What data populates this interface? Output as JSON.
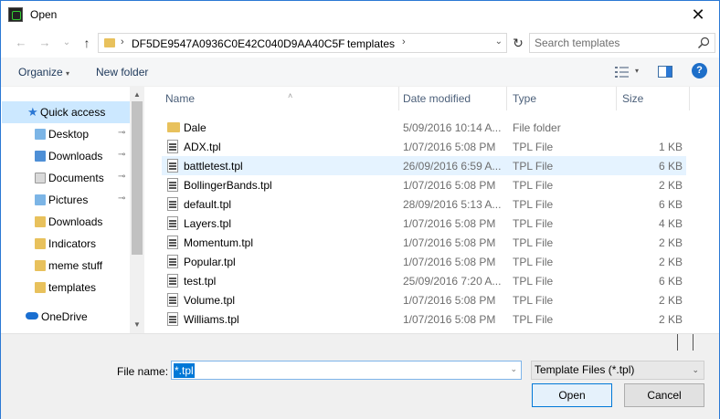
{
  "window": {
    "title": "Open",
    "close_symbol": "✕",
    "icons": {
      "app": "app-icon",
      "close": "close-icon"
    }
  },
  "nav": {
    "back_symbol": "←",
    "forward_symbol": "→",
    "recent_symbol": "⌄",
    "up_symbol": "↑",
    "refresh_symbol": "↻",
    "breadcrumb": [
      "DF5DE9547A0936C0E42C040D9AA40C5F",
      "templates"
    ],
    "breadcrumb_sep": "›",
    "search_placeholder": "Search templates"
  },
  "toolbar": {
    "organize_label": "Organize",
    "organize_caret": "▾",
    "new_folder_label": "New folder",
    "view_caret": "▾",
    "help_label": "?"
  },
  "sidebar": {
    "scroll_up": "▲",
    "scroll_down": "▼",
    "quick_access": "Quick access",
    "items": [
      {
        "label": "Desktop",
        "pinned": true,
        "icon": "desktop-folder-icon"
      },
      {
        "label": "Downloads",
        "pinned": true,
        "icon": "downloads-folder-icon"
      },
      {
        "label": "Documents",
        "pinned": true,
        "icon": "documents-folder-icon"
      },
      {
        "label": "Pictures",
        "pinned": true,
        "icon": "pictures-folder-icon"
      },
      {
        "label": "Downloads",
        "pinned": false,
        "icon": "folder-icon"
      },
      {
        "label": "Indicators",
        "pinned": false,
        "icon": "folder-icon"
      },
      {
        "label": "meme stuff",
        "pinned": false,
        "icon": "folder-icon"
      },
      {
        "label": "templates",
        "pinned": false,
        "icon": "folder-icon"
      }
    ],
    "pin_symbol": "📌",
    "onedrive": "OneDrive"
  },
  "columns": {
    "name": "Name",
    "date": "Date modified",
    "type": "Type",
    "size": "Size",
    "sort_symbol": "˄"
  },
  "files": [
    {
      "name": "Dale",
      "date": "5/09/2016 10:14 A...",
      "type": "File folder",
      "size": "",
      "kind": "folder"
    },
    {
      "name": "ADX.tpl",
      "date": "1/07/2016 5:08 PM",
      "type": "TPL File",
      "size": "1 KB",
      "kind": "file"
    },
    {
      "name": "battletest.tpl",
      "date": "26/09/2016 6:59 A...",
      "type": "TPL File",
      "size": "6 KB",
      "kind": "file",
      "selected": true
    },
    {
      "name": "BollingerBands.tpl",
      "date": "1/07/2016 5:08 PM",
      "type": "TPL File",
      "size": "2 KB",
      "kind": "file"
    },
    {
      "name": "default.tpl",
      "date": "28/09/2016 5:13 A...",
      "type": "TPL File",
      "size": "6 KB",
      "kind": "file"
    },
    {
      "name": "Layers.tpl",
      "date": "1/07/2016 5:08 PM",
      "type": "TPL File",
      "size": "4 KB",
      "kind": "file"
    },
    {
      "name": "Momentum.tpl",
      "date": "1/07/2016 5:08 PM",
      "type": "TPL File",
      "size": "2 KB",
      "kind": "file"
    },
    {
      "name": "Popular.tpl",
      "date": "1/07/2016 5:08 PM",
      "type": "TPL File",
      "size": "2 KB",
      "kind": "file"
    },
    {
      "name": "test.tpl",
      "date": "25/09/2016 7:20 A...",
      "type": "TPL File",
      "size": "6 KB",
      "kind": "file"
    },
    {
      "name": "Volume.tpl",
      "date": "1/07/2016 5:08 PM",
      "type": "TPL File",
      "size": "2 KB",
      "kind": "file"
    },
    {
      "name": "Williams.tpl",
      "date": "1/07/2016 5:08 PM",
      "type": "TPL File",
      "size": "2 KB",
      "kind": "file"
    }
  ],
  "footer": {
    "file_name_label": "File name:",
    "file_name_value": "*.tpl",
    "dropdown_symbol": "⌄",
    "filter_value": "Template Files (*.tpl)",
    "open_label": "Open",
    "cancel_label": "Cancel"
  },
  "colors": {
    "accent": "#0078d7",
    "selection": "#cce8ff",
    "hover_row": "#e5f3ff",
    "folder": "#e8c15c"
  }
}
